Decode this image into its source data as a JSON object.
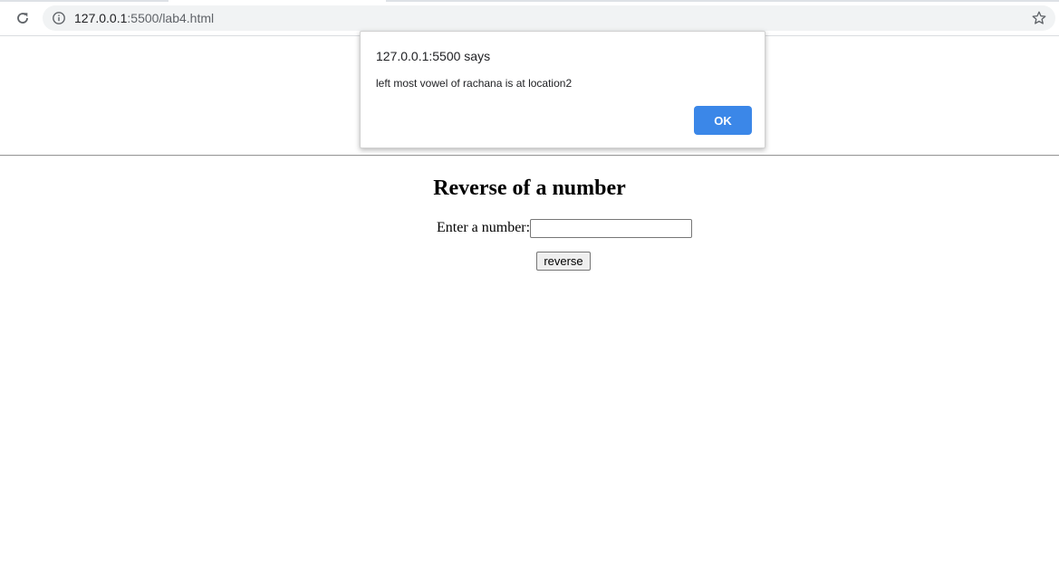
{
  "browser": {
    "url_host": "127.0.0.1",
    "url_rest": ":5500/lab4.html",
    "icons": {
      "reload": "reload-icon",
      "site_info": "info-icon",
      "bookmark": "star-icon"
    }
  },
  "page": {
    "title": "Reverse of a number",
    "input_label": "Enter a number:",
    "input_value": "",
    "button_label": "reverse"
  },
  "alert": {
    "title": "127.0.0.1:5500 says",
    "message": "left most vowel of rachana is at location2",
    "ok_label": "OK",
    "ok_color": "#3b87e8"
  }
}
